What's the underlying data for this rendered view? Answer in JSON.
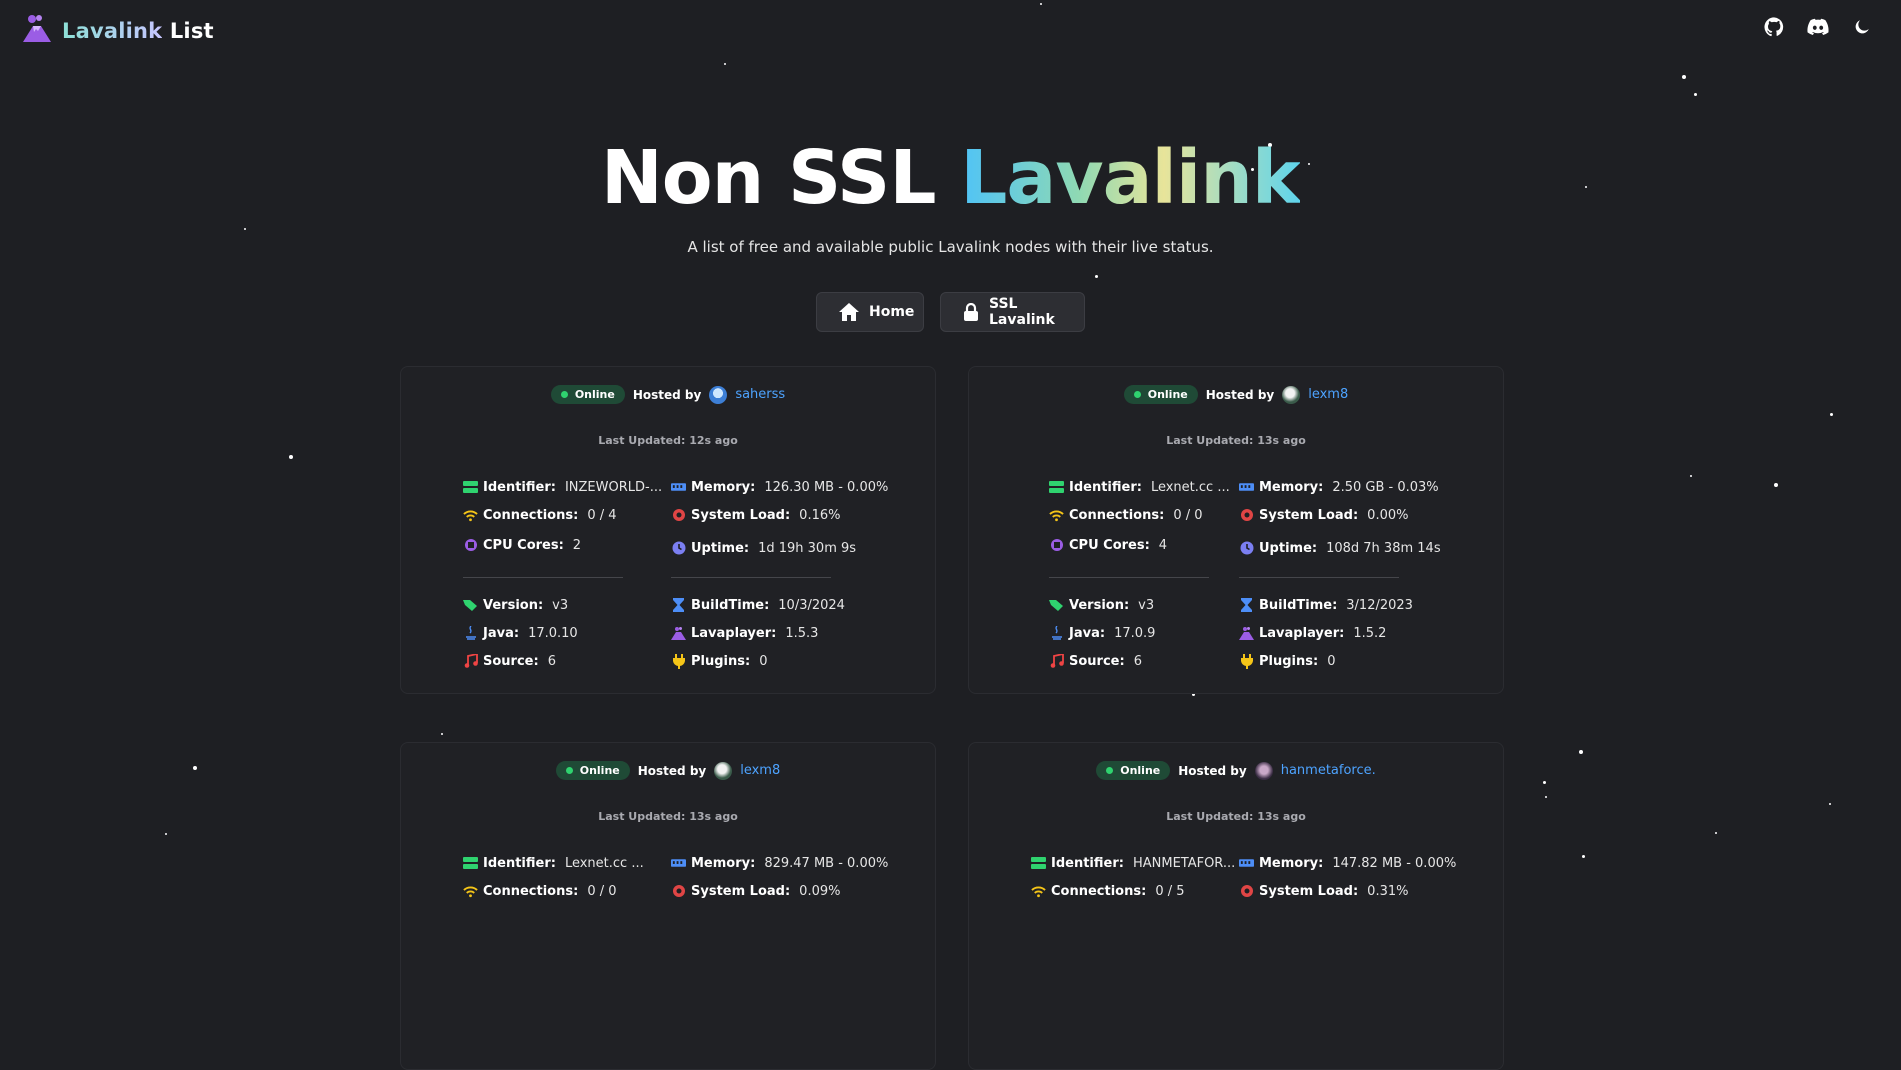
{
  "brand": {
    "name_part1": "Lavalink",
    "name_part2": " List"
  },
  "nav": {
    "icons": [
      "github-icon",
      "discord-icon",
      "moon-icon"
    ]
  },
  "hero": {
    "title_plain": "Non SSL ",
    "title_gradient": "Lavalink",
    "subtitle": "A list of free and available public Lavalink nodes with their live status."
  },
  "buttons": {
    "home": "Home",
    "ssl": "SSL Lavalink"
  },
  "labels": {
    "hosted_by": "Hosted by",
    "identifier": "Identifier:",
    "connections": "Connections:",
    "cpu_cores": "CPU Cores:",
    "memory": "Memory:",
    "system_load": "System Load:",
    "uptime": "Uptime:",
    "version": "Version:",
    "java": "Java:",
    "source": "Source:",
    "buildtime": "BuildTime:",
    "lavaplayer": "Lavaplayer:",
    "plugins": "Plugins:"
  },
  "colors": {
    "accent_blue": "#4da3ff",
    "online_green": "#2fd36f",
    "background": "#1e1f23"
  },
  "nodes": [
    {
      "status": "Online",
      "host": "saherss",
      "updated": "Last Updated: 12s ago",
      "identifier": "INZEWORLD-...",
      "connections": "0 / 4",
      "cpu_cores": "2",
      "memory": "126.30 MB - 0.00%",
      "system_load": "0.16%",
      "uptime": "1d 19h 30m 9s",
      "version": "v3",
      "java": "17.0.10",
      "source": "6",
      "buildtime": "10/3/2024",
      "lavaplayer": "1.5.3",
      "plugins": "0"
    },
    {
      "status": "Online",
      "host": "lexm8",
      "updated": "Last Updated: 13s ago",
      "identifier": "Lexnet.cc ...",
      "connections": "0 / 0",
      "cpu_cores": "4",
      "memory": "2.50 GB - 0.03%",
      "system_load": "0.00%",
      "uptime": "108d 7h 38m 14s",
      "version": "v3",
      "java": "17.0.9",
      "source": "6",
      "buildtime": "3/12/2023",
      "lavaplayer": "1.5.2",
      "plugins": "0"
    },
    {
      "status": "Online",
      "host": "lexm8",
      "updated": "Last Updated: 13s ago",
      "identifier": "Lexnet.cc ...",
      "connections": "0 / 0",
      "memory": "829.47 MB - 0.00%",
      "system_load": "0.09%"
    },
    {
      "status": "Online",
      "host": "hanmetaforce.",
      "updated": "Last Updated: 13s ago",
      "identifier": "HANMETAFOR...",
      "connections": "0 / 5",
      "memory": "147.82 MB - 0.00%",
      "system_load": "0.31%"
    }
  ]
}
